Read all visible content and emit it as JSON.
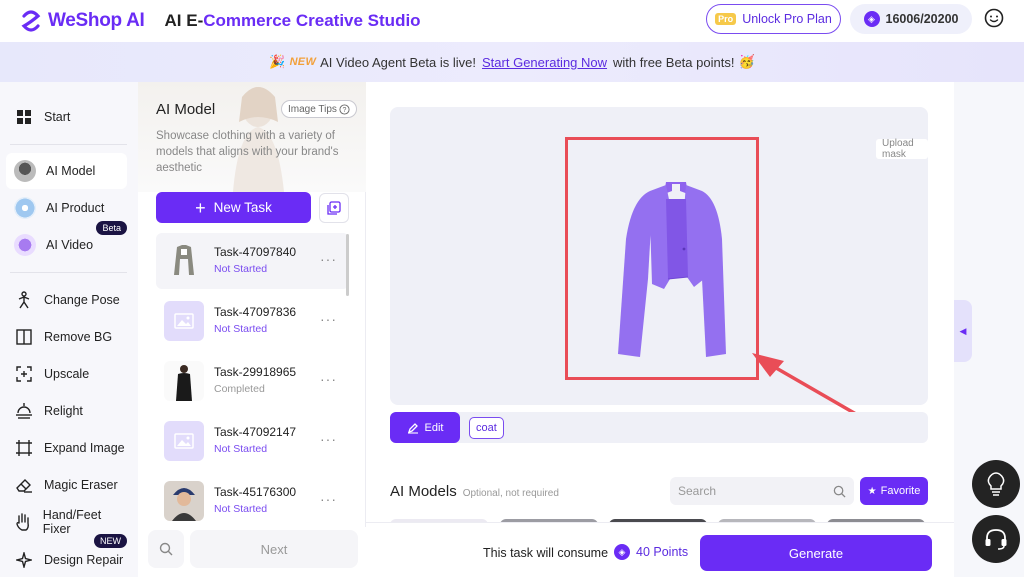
{
  "header": {
    "logo_text": "WeShop AI",
    "app_title_prefix": "AI E-",
    "app_title_rest": "Commerce Creative Studio",
    "pro_tag": "Pro",
    "pro_button": "Unlock Pro Plan",
    "points": "16006/20200"
  },
  "banner": {
    "emoji_left": "🎉",
    "new_tag": "NEW",
    "text_before": "AI Video Agent Beta is live!",
    "link": "Start Generating Now",
    "text_after": "with free Beta points!",
    "emoji_right": "🥳"
  },
  "sidebar": {
    "items": [
      {
        "label": "Start",
        "icon": "grid-icon"
      },
      {
        "label": "AI Model",
        "icon": "avatar-icon"
      },
      {
        "label": "AI Product",
        "icon": "product-icon"
      },
      {
        "label": "AI Video",
        "icon": "video-icon",
        "badge": "Beta"
      },
      {
        "label": "Change Pose",
        "icon": "pose-icon"
      },
      {
        "label": "Remove BG",
        "icon": "remove-bg-icon"
      },
      {
        "label": "Upscale",
        "icon": "upscale-icon"
      },
      {
        "label": "Relight",
        "icon": "relight-icon"
      },
      {
        "label": "Expand Image",
        "icon": "expand-icon"
      },
      {
        "label": "Magic Eraser",
        "icon": "eraser-icon"
      },
      {
        "label": "Hand/Feet Fixer",
        "icon": "hand-icon"
      },
      {
        "label": "Design Repair",
        "icon": "repair-icon",
        "badge": "NEW"
      }
    ]
  },
  "task_panel": {
    "title": "AI Model",
    "tips": "Image Tips",
    "description": "Showcase clothing with a variety of models that aligns with your brand's aesthetic",
    "new_task": "New Task",
    "tasks": [
      {
        "name": "Task-47097840",
        "status": "Not Started"
      },
      {
        "name": "Task-47097836",
        "status": "Not Started"
      },
      {
        "name": "Task-29918965",
        "status": "Completed"
      },
      {
        "name": "Task-47092147",
        "status": "Not Started"
      },
      {
        "name": "Task-45176300",
        "status": "Not Started"
      }
    ],
    "next": "Next"
  },
  "main": {
    "upload_mask": "Upload mask",
    "edit": "Edit",
    "tag": "coat",
    "models_title": "AI Models",
    "models_sub": "Optional, not required",
    "search_placeholder": "Search",
    "favorite": "Favorite",
    "consume_text": "This task will consume",
    "consume_points": "40 Points",
    "generate": "Generate"
  },
  "colors": {
    "accent": "#6a2cf5",
    "highlight_frame": "#e94d57",
    "garment": "#8f63ee"
  }
}
